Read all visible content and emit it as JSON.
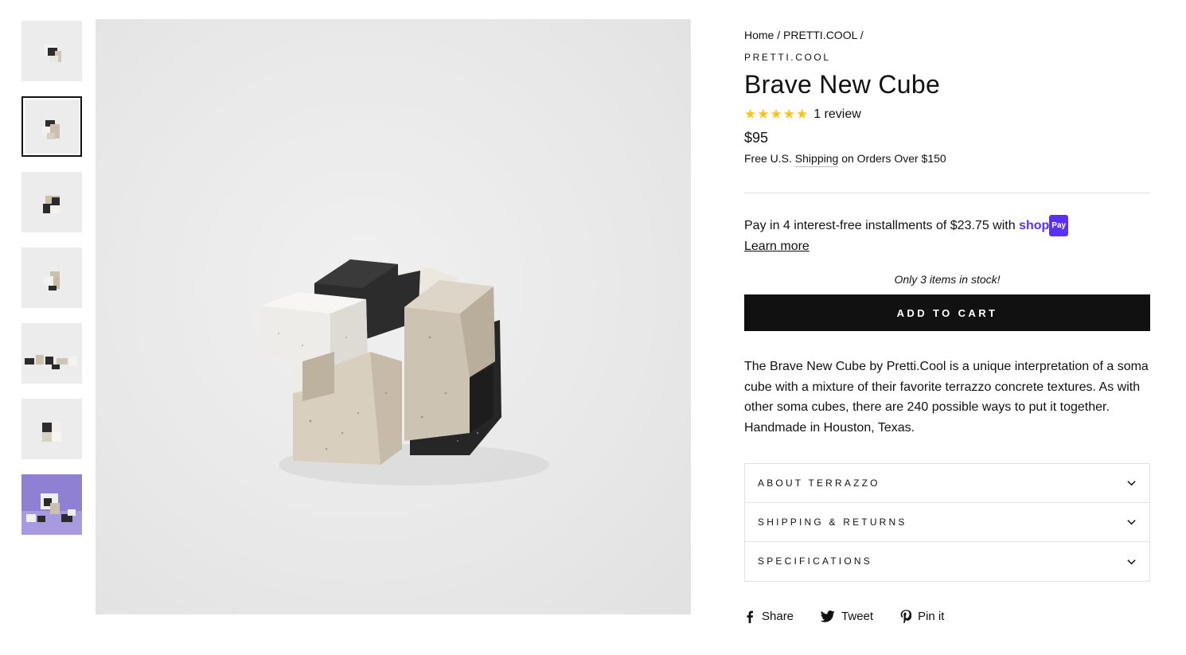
{
  "breadcrumb": {
    "home": "Home",
    "sep1": "/",
    "collection": "PRETTI.COOL",
    "sep2": "/"
  },
  "product": {
    "vendor": "PRETTI.COOL",
    "title": "Brave New Cube",
    "rating_stars": "★★★★★",
    "rating_value": 5,
    "review_count": "1 review",
    "price": "$95",
    "shipping_prefix": "Free U.S.",
    "shipping_link": "Shipping",
    "shipping_suffix": "on Orders Over $150",
    "shoppay_text": "Pay in 4 interest-free installments of $23.75 with",
    "shoppay_logo": "shop",
    "shoppay_badge": "Pay",
    "learn_more": "Learn more",
    "stock_note": "Only 3 items in stock!",
    "add_to_cart": "ADD TO CART",
    "description": "The Brave New Cube by Pretti.Cool is a unique interpretation of a soma cube with a mixture of their favorite terrazzo concrete textures. As with other soma cubes, there are 240 possible ways to put it together. Handmade in Houston, Texas."
  },
  "accordion": [
    {
      "label": "ABOUT TERRAZZO",
      "icon": "chevron-down-icon"
    },
    {
      "label": "SHIPPING & RETURNS",
      "icon": "chevron-down-icon"
    },
    {
      "label": "SPECIFICATIONS",
      "icon": "chevron-down-icon"
    }
  ],
  "social": [
    {
      "label": "Share",
      "icon": "facebook-icon"
    },
    {
      "label": "Tweet",
      "icon": "twitter-icon"
    },
    {
      "label": "Pin it",
      "icon": "pinterest-icon"
    }
  ],
  "thumbnails": {
    "count": 7,
    "active_index": 1
  },
  "colors": {
    "accent": "#111111",
    "star": "#f5c517",
    "shoppay": "#5a31f4",
    "divider": "#e2e2e2"
  }
}
